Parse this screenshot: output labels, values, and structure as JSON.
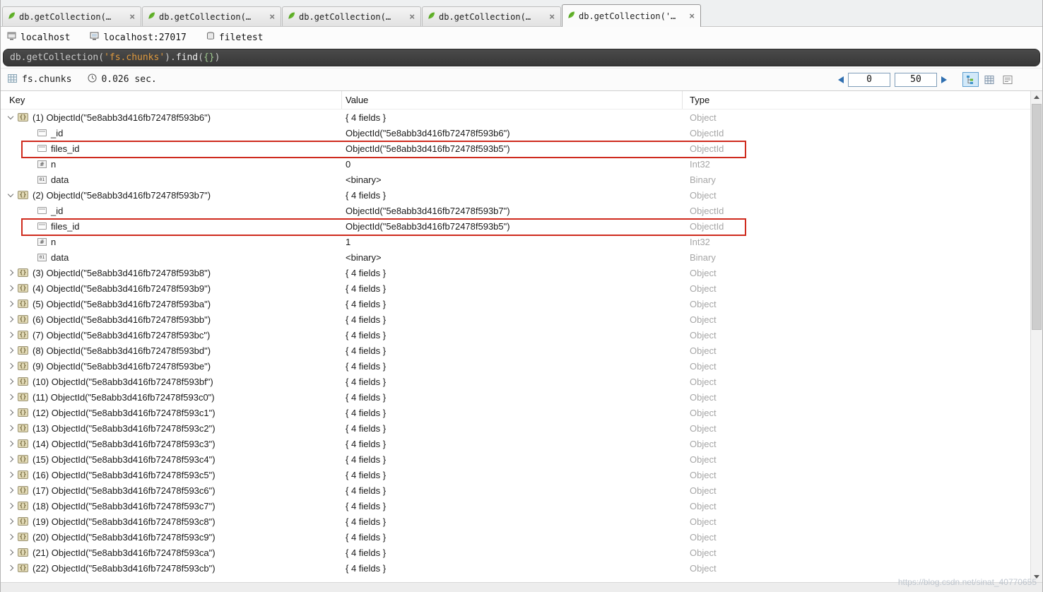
{
  "icons": {
    "tab_close": "×"
  },
  "tabs": [
    {
      "label": "db.getCollection(…",
      "active": false
    },
    {
      "label": "db.getCollection(…",
      "active": false
    },
    {
      "label": "db.getCollection(…",
      "active": false
    },
    {
      "label": "db.getCollection(…",
      "active": false
    },
    {
      "label": "db.getCollection('…",
      "active": true
    }
  ],
  "breadcrumb": {
    "items": [
      {
        "label": "localhost",
        "icon": "server-icon"
      },
      {
        "label": "localhost:27017",
        "icon": "monitor-icon"
      },
      {
        "label": "filetest",
        "icon": "database-icon"
      }
    ]
  },
  "query": {
    "segments": [
      {
        "text": "db.getCollection(",
        "color": "#c8c8c8"
      },
      {
        "text": "'fs.chunks'",
        "color": "#e09a3e"
      },
      {
        "text": ").",
        "color": "#c8c8c8"
      },
      {
        "text": "find",
        "color": "#f2f2f2"
      },
      {
        "text": "(",
        "color": "#c8c8c8"
      },
      {
        "text": "{}",
        "color": "#9fc98f"
      },
      {
        "text": ")",
        "color": "#c8c8c8"
      }
    ]
  },
  "statusbar": {
    "collection": "fs.chunks",
    "time": "0.026 sec."
  },
  "pager": {
    "start": "0",
    "page_size": "50"
  },
  "view_modes": {
    "modes": [
      "tree",
      "table",
      "text"
    ],
    "active": "tree"
  },
  "highlight_color": "#cf2b1e",
  "table": {
    "columns": [
      "Key",
      "Value",
      "Type"
    ],
    "rows": [
      {
        "kind": "doc",
        "expanded": true,
        "key": "(1) ObjectId(\"5e8abb3d416fb72478f593b6\")",
        "value": "{ 4 fields }",
        "type": "Object"
      },
      {
        "kind": "child",
        "icon": "field",
        "key": "_id",
        "value": "ObjectId(\"5e8abb3d416fb72478f593b6\")",
        "type": "ObjectId"
      },
      {
        "kind": "child",
        "icon": "field",
        "key": "files_id",
        "value": "ObjectId(\"5e8abb3d416fb72478f593b5\")",
        "type": "ObjectId",
        "highlight": true
      },
      {
        "kind": "child",
        "icon": "int",
        "key": "n",
        "value": "0",
        "type": "Int32"
      },
      {
        "kind": "child",
        "icon": "binary",
        "key": "data",
        "value": "<binary>",
        "type": "Binary"
      },
      {
        "kind": "doc",
        "expanded": true,
        "key": "(2) ObjectId(\"5e8abb3d416fb72478f593b7\")",
        "value": "{ 4 fields }",
        "type": "Object"
      },
      {
        "kind": "child",
        "icon": "field",
        "key": "_id",
        "value": "ObjectId(\"5e8abb3d416fb72478f593b7\")",
        "type": "ObjectId"
      },
      {
        "kind": "child",
        "icon": "field",
        "key": "files_id",
        "value": "ObjectId(\"5e8abb3d416fb72478f593b5\")",
        "type": "ObjectId",
        "highlight": true
      },
      {
        "kind": "child",
        "icon": "int",
        "key": "n",
        "value": "1",
        "type": "Int32"
      },
      {
        "kind": "child",
        "icon": "binary",
        "key": "data",
        "value": "<binary>",
        "type": "Binary"
      },
      {
        "kind": "doc",
        "expanded": false,
        "key": "(3) ObjectId(\"5e8abb3d416fb72478f593b8\")",
        "value": "{ 4 fields }",
        "type": "Object"
      },
      {
        "kind": "doc",
        "expanded": false,
        "key": "(4) ObjectId(\"5e8abb3d416fb72478f593b9\")",
        "value": "{ 4 fields }",
        "type": "Object"
      },
      {
        "kind": "doc",
        "expanded": false,
        "key": "(5) ObjectId(\"5e8abb3d416fb72478f593ba\")",
        "value": "{ 4 fields }",
        "type": "Object"
      },
      {
        "kind": "doc",
        "expanded": false,
        "key": "(6) ObjectId(\"5e8abb3d416fb72478f593bb\")",
        "value": "{ 4 fields }",
        "type": "Object"
      },
      {
        "kind": "doc",
        "expanded": false,
        "key": "(7) ObjectId(\"5e8abb3d416fb72478f593bc\")",
        "value": "{ 4 fields }",
        "type": "Object"
      },
      {
        "kind": "doc",
        "expanded": false,
        "key": "(8) ObjectId(\"5e8abb3d416fb72478f593bd\")",
        "value": "{ 4 fields }",
        "type": "Object"
      },
      {
        "kind": "doc",
        "expanded": false,
        "key": "(9) ObjectId(\"5e8abb3d416fb72478f593be\")",
        "value": "{ 4 fields }",
        "type": "Object"
      },
      {
        "kind": "doc",
        "expanded": false,
        "key": "(10) ObjectId(\"5e8abb3d416fb72478f593bf\")",
        "value": "{ 4 fields }",
        "type": "Object"
      },
      {
        "kind": "doc",
        "expanded": false,
        "key": "(11) ObjectId(\"5e8abb3d416fb72478f593c0\")",
        "value": "{ 4 fields }",
        "type": "Object"
      },
      {
        "kind": "doc",
        "expanded": false,
        "key": "(12) ObjectId(\"5e8abb3d416fb72478f593c1\")",
        "value": "{ 4 fields }",
        "type": "Object"
      },
      {
        "kind": "doc",
        "expanded": false,
        "key": "(13) ObjectId(\"5e8abb3d416fb72478f593c2\")",
        "value": "{ 4 fields }",
        "type": "Object"
      },
      {
        "kind": "doc",
        "expanded": false,
        "key": "(14) ObjectId(\"5e8abb3d416fb72478f593c3\")",
        "value": "{ 4 fields }",
        "type": "Object"
      },
      {
        "kind": "doc",
        "expanded": false,
        "key": "(15) ObjectId(\"5e8abb3d416fb72478f593c4\")",
        "value": "{ 4 fields }",
        "type": "Object"
      },
      {
        "kind": "doc",
        "expanded": false,
        "key": "(16) ObjectId(\"5e8abb3d416fb72478f593c5\")",
        "value": "{ 4 fields }",
        "type": "Object"
      },
      {
        "kind": "doc",
        "expanded": false,
        "key": "(17) ObjectId(\"5e8abb3d416fb72478f593c6\")",
        "value": "{ 4 fields }",
        "type": "Object"
      },
      {
        "kind": "doc",
        "expanded": false,
        "key": "(18) ObjectId(\"5e8abb3d416fb72478f593c7\")",
        "value": "{ 4 fields }",
        "type": "Object"
      },
      {
        "kind": "doc",
        "expanded": false,
        "key": "(19) ObjectId(\"5e8abb3d416fb72478f593c8\")",
        "value": "{ 4 fields }",
        "type": "Object"
      },
      {
        "kind": "doc",
        "expanded": false,
        "key": "(20) ObjectId(\"5e8abb3d416fb72478f593c9\")",
        "value": "{ 4 fields }",
        "type": "Object"
      },
      {
        "kind": "doc",
        "expanded": false,
        "key": "(21) ObjectId(\"5e8abb3d416fb72478f593ca\")",
        "value": "{ 4 fields }",
        "type": "Object"
      },
      {
        "kind": "doc",
        "expanded": false,
        "key": "(22) ObjectId(\"5e8abb3d416fb72478f593cb\")",
        "value": "{ 4 fields }",
        "type": "Object"
      }
    ]
  },
  "watermark": "https://blog.csdn.net/sinat_40770655"
}
